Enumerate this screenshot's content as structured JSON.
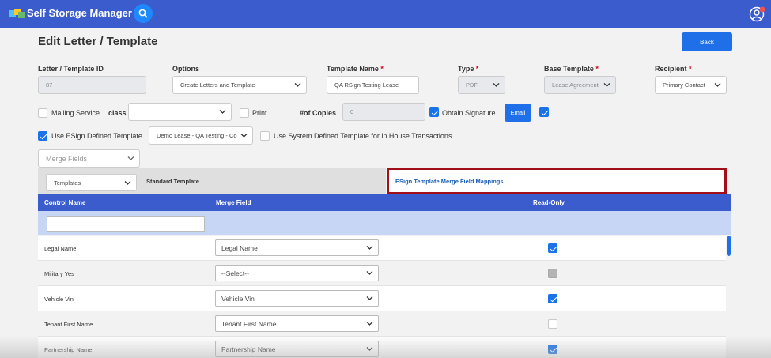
{
  "app": {
    "title": "Self Storage Manager"
  },
  "page": {
    "title": "Edit Letter / Template",
    "back_label": "Back"
  },
  "form": {
    "letter_id": {
      "label": "Letter / Template ID",
      "value": "87"
    },
    "options": {
      "label": "Options",
      "value": "Create Letters and Template"
    },
    "template_name": {
      "label": "Template Name",
      "value": "QA RSign Testing Lease"
    },
    "type": {
      "label": "Type",
      "value": "PDF"
    },
    "base_template": {
      "label": "Base Template",
      "value": "Lease Agreement"
    },
    "recipient": {
      "label": "Recipient",
      "value": "Primary Contact"
    },
    "required_mark": "*",
    "mailing_service": {
      "label": "Mailing Service",
      "checked": false
    },
    "class": {
      "label": "class",
      "value": ""
    },
    "print": {
      "label": "Print",
      "checked": false
    },
    "copies": {
      "label": "#of Copies",
      "value": "0"
    },
    "obtain_signature": {
      "label": "Obtain Signature",
      "checked": true
    },
    "email_label": "Email",
    "email_checked": true,
    "use_esign": {
      "label": "Use ESign Defined Template",
      "checked": true
    },
    "esign_template": {
      "value": "Demo Lease - QA Testing - Co"
    },
    "use_system": {
      "label": "Use System Defined Template for in House Transactions",
      "checked": false
    },
    "merge_fields": {
      "placeholder": "Merge Fields"
    }
  },
  "tabs": {
    "templates_select": "Templates",
    "standard": "Standard Template",
    "esign_mappings": "ESign Template Merge Field Mappings"
  },
  "table": {
    "headers": {
      "control": "Control Name",
      "merge": "Merge Field",
      "readonly": "Read-Only"
    },
    "rows": [
      {
        "control": "Legal Name",
        "merge": "Legal Name",
        "readonly": "checked"
      },
      {
        "control": "Military Yes",
        "merge": "--Select--",
        "readonly": "disabled"
      },
      {
        "control": "Vehicle Vin",
        "merge": "Vehicle Vin",
        "readonly": "checked"
      },
      {
        "control": "Tenant First Name",
        "merge": "Tenant First Name",
        "readonly": "unchecked"
      },
      {
        "control": "Partnership Name",
        "merge": "Partnership Name",
        "readonly": "checked"
      }
    ]
  },
  "colors": {
    "topbar": "#3a5ccc",
    "primary_button": "#1e6fe8",
    "highlight_border": "#a30f18"
  }
}
